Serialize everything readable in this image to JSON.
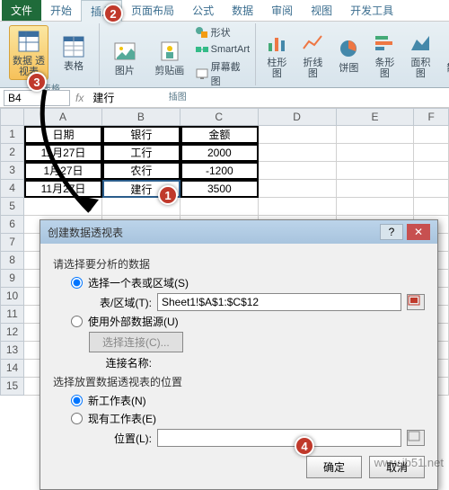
{
  "tabs": {
    "file": "文件",
    "start": "开始",
    "insert": "插入",
    "layout": "页面布局",
    "formula": "公式",
    "data": "数据",
    "review": "审阅",
    "view": "视图",
    "dev": "开发工具"
  },
  "ribbon": {
    "pivot": "数据\n透视表",
    "table": "表格",
    "pic": "图片",
    "clip": "剪贴画",
    "shapes": "形状",
    "smartart": "SmartArt",
    "screenshot": "屏幕截图",
    "col": "柱形图",
    "line": "折线图",
    "pie": "饼图",
    "bar": "条形图",
    "area": "面积图",
    "scatter": "散点",
    "g_tables": "表格",
    "g_illus": "插图"
  },
  "formula": {
    "name": "B4",
    "fx": "fx",
    "val": "建行"
  },
  "cols": [
    "A",
    "B",
    "C",
    "D",
    "E",
    "F"
  ],
  "rows": [
    "1",
    "2",
    "3",
    "4",
    "5",
    "6",
    "7",
    "8",
    "9",
    "10",
    "11",
    "12",
    "13",
    "14",
    "15"
  ],
  "grid": {
    "h1": "日期",
    "h2": "银行",
    "h3": "金额",
    "r2c1": "11月27日",
    "r2c2": "工行",
    "r2c3": "2000",
    "r3c1": "1月27日",
    "r3c2": "农行",
    "r3c3": "-1200",
    "r4c1": "11月27日",
    "r4c2": "建行",
    "r4c3": "3500"
  },
  "dlg": {
    "title": "创建数据透视表",
    "s1": "请选择要分析的数据",
    "r1": "选择一个表或区域(S)",
    "rangeLabel": "表/区域(T):",
    "rangeVal": "Sheet1!$A$1:$C$12",
    "r2": "使用外部数据源(U)",
    "chooseConn": "选择连接(C)...",
    "connLabel": "连接名称:",
    "s2": "选择放置数据透视表的位置",
    "r3": "新工作表(N)",
    "r4": "现有工作表(E)",
    "locLabel": "位置(L):",
    "ok": "确定",
    "cancel": "取消"
  },
  "callouts": {
    "c1": "1",
    "c2": "2",
    "c3": "3",
    "c4": "4"
  },
  "watermark": "www.jb51.net"
}
